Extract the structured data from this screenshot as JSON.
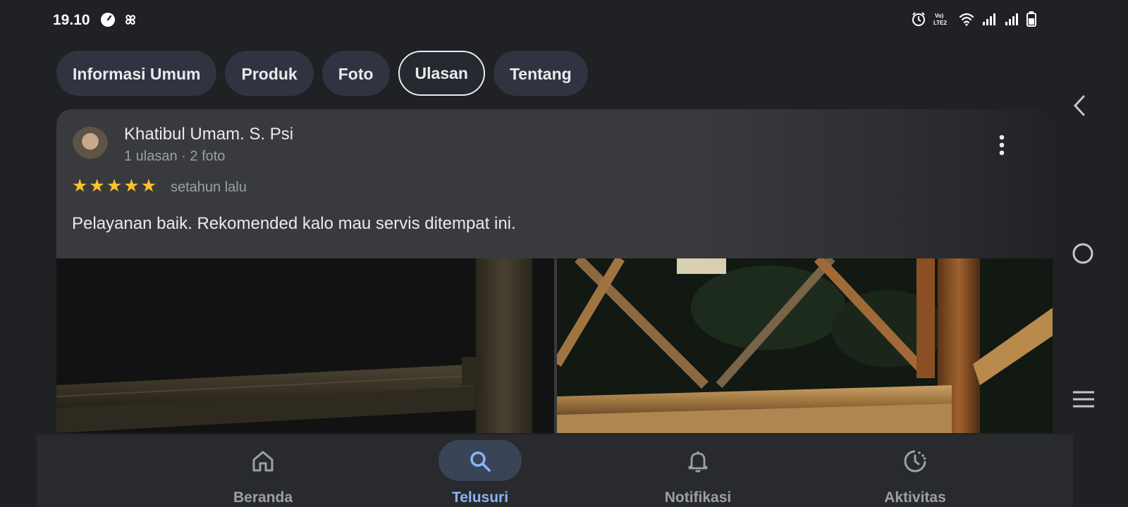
{
  "status_bar": {
    "time": "19.10",
    "left_icons": [
      "speedometer-icon",
      "pinwheel-icon"
    ],
    "right_icons": [
      "alarm-icon",
      "volte-icon",
      "wifi-icon",
      "signal-icon",
      "signal-icon",
      "battery-icon"
    ],
    "volte_label": "Vo) LTE2"
  },
  "tabs": [
    {
      "label": "Informasi Umum",
      "active": false
    },
    {
      "label": "Produk",
      "active": false
    },
    {
      "label": "Foto",
      "active": false
    },
    {
      "label": "Ulasan",
      "active": true
    },
    {
      "label": "Tentang",
      "active": false
    }
  ],
  "review": {
    "reviewer_name": "Khatibul Umam. S. Psi",
    "reviewer_meta": "1 ulasan · 2 foto",
    "rating": 5,
    "time": "setahun lalu",
    "text": "Pelayanan baik. Rekomended kalo mau servis ditempat ini.",
    "photos": [
      "bamboo-fence-night-photo",
      "bamboo-railing-night-photo"
    ]
  },
  "side_nav": [
    "back-icon",
    "home-circle-icon",
    "recents-icon"
  ],
  "bottom_nav": [
    {
      "label": "Beranda",
      "icon": "home-icon",
      "active": false
    },
    {
      "label": "Telusuri",
      "icon": "search-icon",
      "active": true
    },
    {
      "label": "Notifikasi",
      "icon": "bell-icon",
      "active": false
    },
    {
      "label": "Aktivitas",
      "icon": "activity-icon",
      "active": false
    }
  ],
  "colors": {
    "background": "#202124",
    "card": "#393a3d",
    "tab": "#303441",
    "active_nav": "#8ab4f8",
    "star": "#fbc02d"
  }
}
